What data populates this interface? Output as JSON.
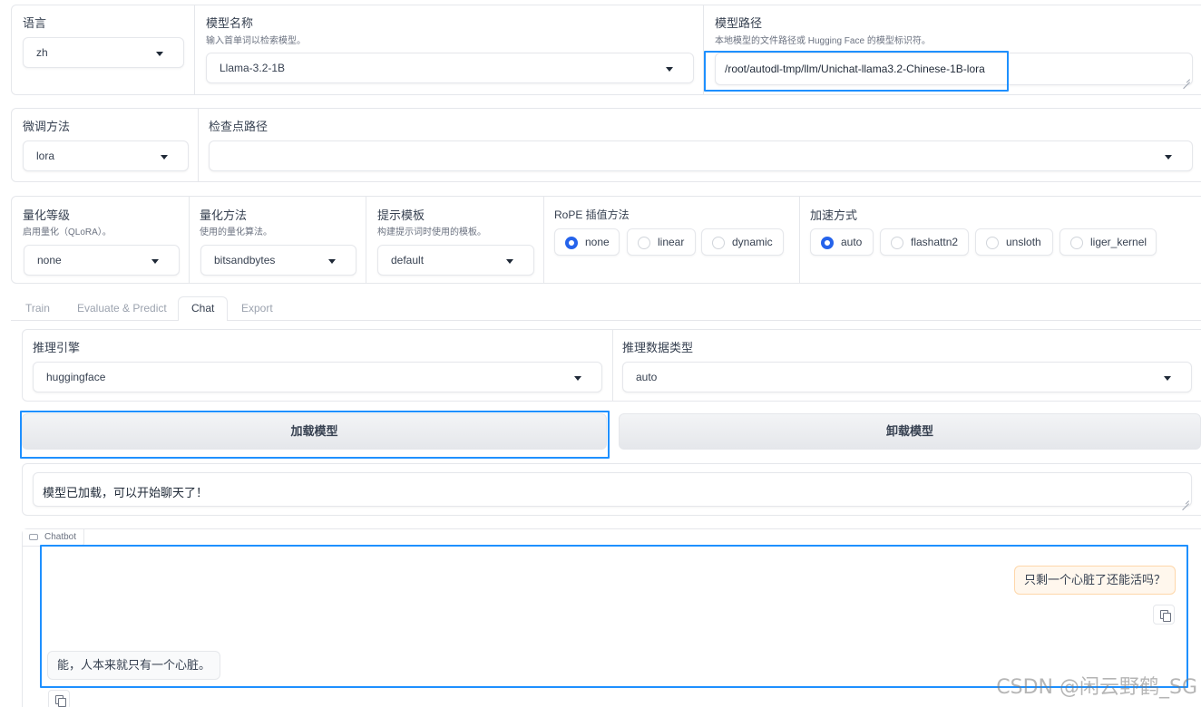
{
  "top_row": {
    "language": {
      "label": "语言",
      "value": "zh"
    },
    "model_name": {
      "label": "模型名称",
      "info": "输入首单词以检索模型。",
      "value": "Llama-3.2-1B"
    },
    "model_path": {
      "label": "模型路径",
      "info": "本地模型的文件路径或 Hugging Face 的模型标识符。",
      "value": "/root/autodl-tmp/llm/Unichat-llama3.2-Chinese-1B-lora"
    }
  },
  "second_row": {
    "finetuning_type": {
      "label": "微调方法",
      "value": "lora"
    },
    "checkpoint_path": {
      "label": "检查点路径",
      "value": ""
    }
  },
  "third_row": {
    "quantization_bit": {
      "label": "量化等级",
      "info": "启用量化（QLoRA）。",
      "value": "none"
    },
    "quantization_method": {
      "label": "量化方法",
      "info": "使用的量化算法。",
      "value": "bitsandbytes"
    },
    "template": {
      "label": "提示模板",
      "info": "构建提示词时使用的模板。",
      "value": "default"
    },
    "rope_scaling": {
      "label": "RoPE 插值方法",
      "options": [
        "none",
        "linear",
        "dynamic"
      ],
      "selected": "none"
    },
    "booster": {
      "label": "加速方式",
      "options": [
        "auto",
        "flashattn2",
        "unsloth",
        "liger_kernel"
      ],
      "selected": "auto"
    }
  },
  "tabs": [
    {
      "label": "Train",
      "active": false
    },
    {
      "label": "Evaluate & Predict",
      "active": false
    },
    {
      "label": "Chat",
      "active": true
    },
    {
      "label": "Export",
      "active": false
    }
  ],
  "chat": {
    "infer_backend": {
      "label": "推理引擎",
      "value": "huggingface"
    },
    "infer_dtype": {
      "label": "推理数据类型",
      "value": "auto"
    },
    "load_button": "加载模型",
    "unload_button": "卸载模型",
    "status_text": "模型已加载，可以开始聊天了！",
    "chatbot_label": "Chatbot",
    "messages": [
      {
        "role": "user",
        "text": "只剩一个心脏了还能活吗？"
      },
      {
        "role": "assistant",
        "text": "能，人本来就只有一个心脏。"
      }
    ]
  },
  "watermark": "CSDN @闲云野鹤_SG",
  "colors": {
    "accent": "#2563eb",
    "highlight": "#1e90ff",
    "user_bubble": "#fff7ed"
  }
}
